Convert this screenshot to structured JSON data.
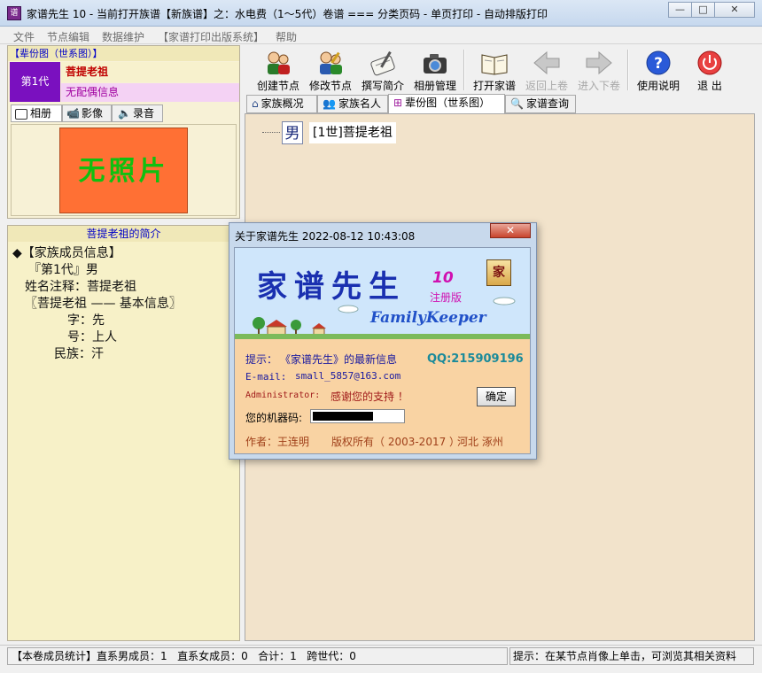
{
  "window": {
    "title": "家谱先生 10 - 当前打开族谱【新族谱】之：水电费（1～5代）卷谱 === 分类页码 - 单页打印 - 自动排版打印",
    "icon": "family-book-icon",
    "minimize": "—",
    "maximize": "□",
    "close": "✕"
  },
  "menu": [
    "文件",
    "节点编辑",
    "数据维护",
    "【家谱打印出版系统】",
    "帮助"
  ],
  "left_panel": {
    "header": "【辈份图（世系图）】",
    "generation": "第1代",
    "ancestor_name": "菩提老祖",
    "spouse_info": "无配偶信息",
    "tabs": [
      {
        "label": "相册",
        "icon": "camera-icon"
      },
      {
        "label": "影像",
        "icon": "video-icon"
      },
      {
        "label": "录音",
        "icon": "speaker-icon"
      }
    ],
    "no_photo": "无照片",
    "intro_header": "菩提老祖的简介",
    "intro_lines": [
      "◆【家族成员信息】",
      "『第1代』男",
      "姓名注释：菩提老祖",
      "〖菩提老祖 —— 基本信息〗",
      "字：先",
      "号：上人",
      "民族：汗"
    ]
  },
  "toolbar": [
    {
      "label": "创建节点",
      "icon": "create-node-icon",
      "enabled": true
    },
    {
      "label": "修改节点",
      "icon": "edit-node-icon",
      "enabled": true
    },
    {
      "label": "撰写简介",
      "icon": "write-intro-icon",
      "enabled": true
    },
    {
      "label": "相册管理",
      "icon": "camera-icon",
      "enabled": true
    },
    {
      "label": "打开家谱",
      "icon": "open-book-icon",
      "enabled": true
    },
    {
      "label": "返回上卷",
      "icon": "arrow-left-icon",
      "enabled": false
    },
    {
      "label": "进入下卷",
      "icon": "arrow-right-icon",
      "enabled": false
    },
    {
      "label": "使用说明",
      "icon": "help-icon",
      "enabled": true
    },
    {
      "label": "退  出",
      "icon": "power-icon",
      "enabled": true
    }
  ],
  "main_tabs": [
    {
      "label": "家族概况",
      "icon": "house-icon"
    },
    {
      "label": "家族名人",
      "icon": "people-icon"
    },
    {
      "label": "辈份图（世系图）",
      "icon": "tree-icon"
    },
    {
      "label": "家谱查询",
      "icon": "search-person-icon"
    }
  ],
  "tree": {
    "node_gender": "男",
    "node_label": "[1世]菩提老祖"
  },
  "status": {
    "left": "【本卷成员统计】直系男成员：1   直系女成员：0   合计：1   跨世代：0",
    "right": "提示：在某节点肖像上单击，可浏览其相关资料"
  },
  "dialog": {
    "title": "关于家谱先生   2022-08-12 10:43:08",
    "close": "✕",
    "brand": "家谱先生",
    "version": "10",
    "registered": "注册版",
    "book_glyph": "家",
    "english": "FamilyKeeper",
    "tip_label": "提示：",
    "tip_text": "《家谱先生》的最新信息",
    "qq": "QQ:215909196",
    "email_label": "E-mail:",
    "email": "small_5857@163.com",
    "admin_label": "Administrator:",
    "thanks": "感谢您的支持 ！",
    "ok": "确定",
    "machine_label": "您的机器码:",
    "author": "作者：王连明",
    "copyright": "版权所有（ 2003-2017 ）",
    "location": "河北   涿州"
  },
  "colors": {
    "generation_bg": "#7a10bf",
    "no_photo_bg": "#ff7034",
    "main_bg": "#f2e3cb",
    "panel_bg": "#f7f1c8",
    "brand_blue": "#1a30b0"
  }
}
